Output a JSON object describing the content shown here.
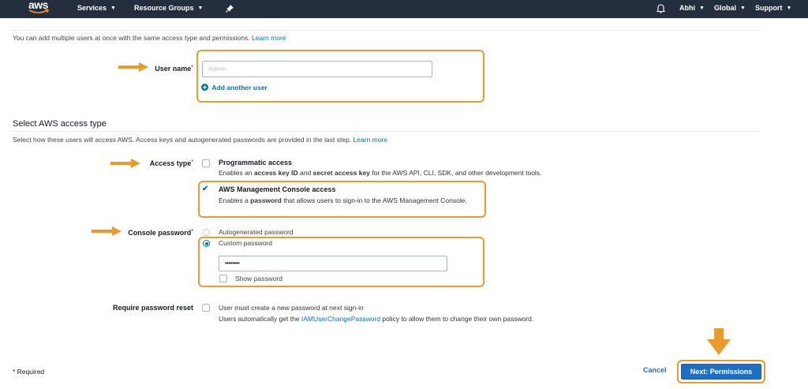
{
  "nav": {
    "logo": "aws",
    "services": "Services",
    "resource_groups": "Resource Groups",
    "user": "Abhi",
    "region": "Global",
    "support": "Support"
  },
  "intro": {
    "text": "You can add multiple users at once with the same access type and permissions.",
    "learn_more": "Learn more"
  },
  "user_name": {
    "label": "User name",
    "required_mark": "*",
    "value": "Admin",
    "add_another": "Add another user"
  },
  "access_section": {
    "heading": "Select AWS access type",
    "description": "Select how these users will access AWS. Access keys and autogenerated passwords are provided in the last step.",
    "learn_more": "Learn more"
  },
  "access_type": {
    "label": "Access type",
    "required_mark": "*",
    "programmatic": {
      "title": "Programmatic access",
      "checked": false,
      "desc_parts": [
        "Enables an ",
        "access key ID",
        " and ",
        "secret access key",
        " for the AWS API, CLI, SDK, and other development tools."
      ]
    },
    "console": {
      "title": "AWS Management Console access",
      "checked": true,
      "desc_parts": [
        "Enables a ",
        "password",
        " that allows users to sign-in to the AWS Management Console."
      ]
    }
  },
  "console_password": {
    "label": "Console password",
    "required_mark": "*",
    "autogenerated": "Autogenerated password",
    "custom": "Custom password",
    "selected": "custom",
    "value": "••••••••",
    "show_password": "Show password"
  },
  "password_reset": {
    "label": "Require password reset",
    "line1": "User must create a new password at next sign-in",
    "line2_parts": [
      "Users automatically get the ",
      "IAMUserChangePassword",
      " policy to allow them to change their own password."
    ]
  },
  "footer": {
    "required_note": "* Required",
    "cancel": "Cancel",
    "next": "Next: Permissions"
  },
  "colors": {
    "nav_bg": "#232f3e",
    "highlight": "#ec9a2a",
    "link": "#0073bb",
    "primary_button": "#1e6ec4"
  }
}
